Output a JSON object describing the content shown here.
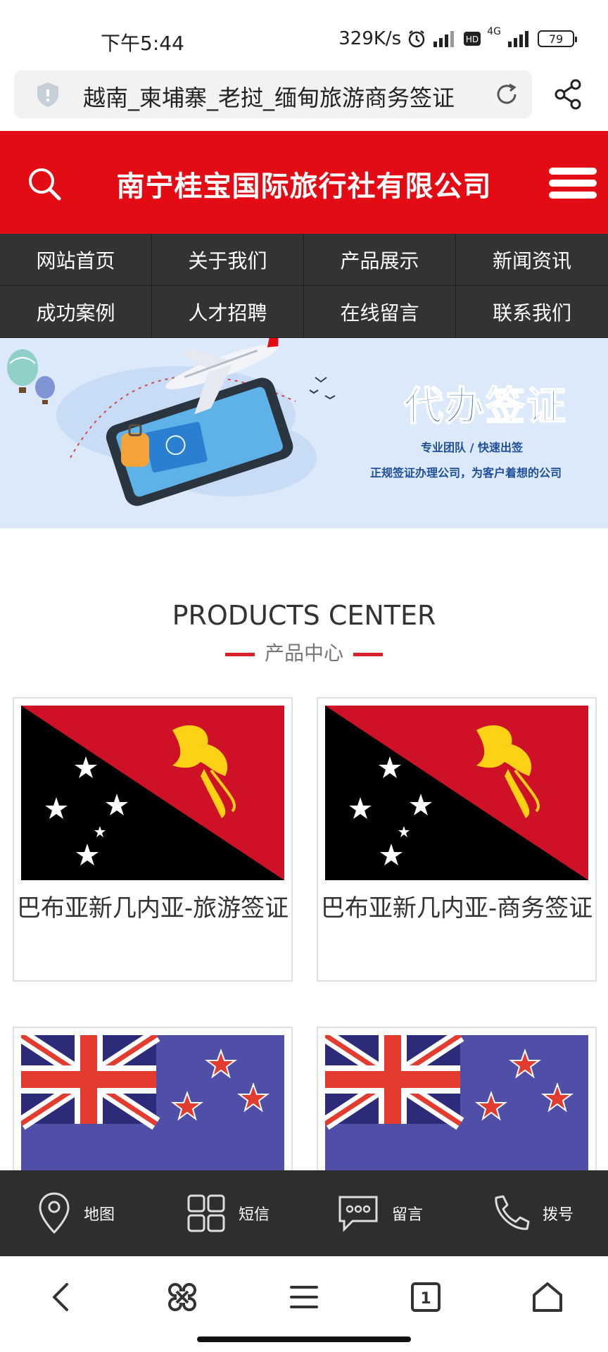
{
  "status": {
    "time": "下午5:44",
    "net_speed": "329K/s",
    "network": "4G",
    "battery": "79"
  },
  "browser": {
    "url_title": "越南_柬埔寨_老挝_缅甸旅游商务签证"
  },
  "header": {
    "company": "南宁桂宝国际旅行社有限公司"
  },
  "nav": {
    "items": [
      "网站首页",
      "关于我们",
      "产品展示",
      "新闻资讯",
      "成功案例",
      "人才招聘",
      "在线留言",
      "联系我们"
    ]
  },
  "banner": {
    "title": "代办签证",
    "sub1": "专业团队 / 快速出签",
    "sub2": "正规签证办理公司，为客户着想的公司"
  },
  "products": {
    "title": "PRODUCTS CENTER",
    "subtitle": "产品中心",
    "items": [
      {
        "name": "巴布亚新几内亚-旅游签证",
        "flag": "papua-new-guinea"
      },
      {
        "name": "巴布亚新几内亚-商务签证",
        "flag": "papua-new-guinea"
      },
      {
        "name": "",
        "flag": "new-zealand"
      },
      {
        "name": "",
        "flag": "new-zealand"
      }
    ]
  },
  "action_bar": {
    "items": [
      {
        "label": "地图",
        "icon": "map-pin-icon"
      },
      {
        "label": "短信",
        "icon": "grid-icon"
      },
      {
        "label": "留言",
        "icon": "message-icon"
      },
      {
        "label": "拨号",
        "icon": "phone-icon"
      }
    ]
  },
  "colors": {
    "header_red": "#e30c14",
    "nav_dark": "#333333",
    "accent_red": "#d8232a",
    "banner_bg": "#dbe9fb"
  }
}
